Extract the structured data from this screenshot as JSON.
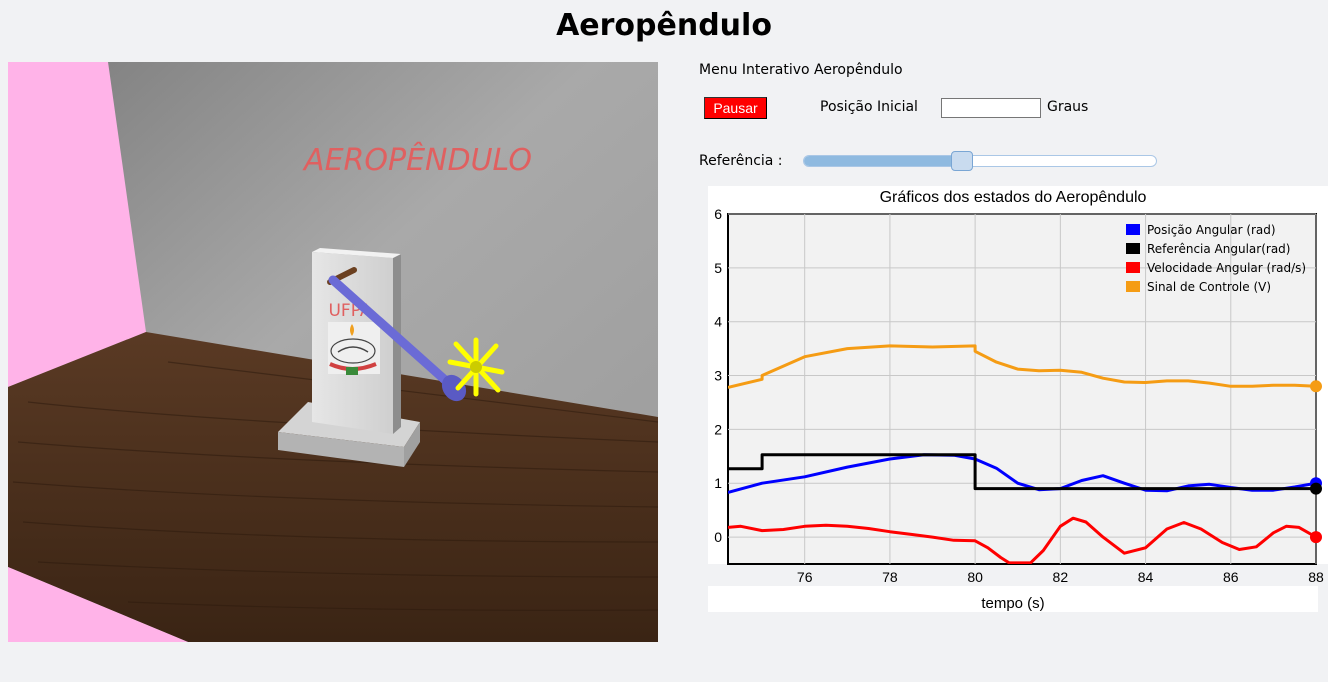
{
  "page": {
    "title": "Aeropêndulo"
  },
  "scene": {
    "wall_text": "AEROPÊNDULO",
    "logo_text": "UFPA",
    "colors": {
      "left_wall": "#ffb3e8",
      "back_wall": "#9e9e9e",
      "table": "#4a2e1c",
      "arm": "#6b6bd6",
      "propeller": "#ffff00"
    }
  },
  "menu": {
    "title": "Menu Interativo Aeropêndulo",
    "pause_label": "Pausar",
    "initial_position_label": "Posição Inicial",
    "initial_position_value": "",
    "initial_position_unit": "Graus",
    "reference_label": "Referência :",
    "reference_slider_fraction": 0.45
  },
  "chart_data": {
    "type": "line",
    "title": "Gráficos dos estados do Aeropêndulo",
    "xlabel": "tempo (s)",
    "ylabel": "",
    "xlim": [
      74.2,
      88
    ],
    "ylim": [
      -0.5,
      6
    ],
    "xticks": [
      76,
      78,
      80,
      82,
      84,
      86,
      88
    ],
    "yticks": [
      0,
      1,
      2,
      3,
      4,
      5,
      6
    ],
    "grid": true,
    "legend_position": "top-right",
    "series": [
      {
        "name": "Posição Angular (rad)",
        "color": "#0000ff",
        "x": [
          74.2,
          75,
          76,
          77,
          78,
          78.8,
          79.5,
          80,
          80.5,
          81,
          81.5,
          82,
          82.5,
          83,
          83.5,
          84,
          84.5,
          85,
          85.5,
          86,
          86.5,
          87,
          87.5,
          88
        ],
        "y": [
          0.83,
          1.0,
          1.12,
          1.3,
          1.45,
          1.53,
          1.52,
          1.45,
          1.28,
          1.0,
          0.88,
          0.9,
          1.05,
          1.14,
          1.0,
          0.87,
          0.86,
          0.95,
          0.98,
          0.92,
          0.87,
          0.87,
          0.93,
          1.0
        ]
      },
      {
        "name": "Referência Angular(rad)",
        "color": "#000000",
        "x": [
          74.2,
          75,
          75,
          80,
          80,
          88
        ],
        "y": [
          1.27,
          1.27,
          1.53,
          1.53,
          0.9,
          0.9
        ]
      },
      {
        "name": "Velocidade Angular (rad/s)",
        "color": "#ff0000",
        "x": [
          74.2,
          74.5,
          75,
          75.5,
          76,
          76.5,
          77,
          77.5,
          78,
          78.5,
          79,
          79.5,
          80,
          80.3,
          80.6,
          80.8,
          81.3,
          81.6,
          82,
          82.3,
          82.6,
          83,
          83.5,
          84,
          84.5,
          84.9,
          85.3,
          85.8,
          86.2,
          86.6,
          87,
          87.3,
          87.6,
          88
        ],
        "y": [
          0.18,
          0.2,
          0.12,
          0.14,
          0.2,
          0.22,
          0.2,
          0.16,
          0.1,
          0.05,
          0.0,
          -0.06,
          -0.07,
          -0.2,
          -0.38,
          -0.48,
          -0.48,
          -0.25,
          0.2,
          0.35,
          0.28,
          0.0,
          -0.3,
          -0.2,
          0.15,
          0.27,
          0.15,
          -0.1,
          -0.23,
          -0.18,
          0.08,
          0.2,
          0.18,
          0.0
        ]
      },
      {
        "name": "Sinal de Controle (V)",
        "color": "#f59c14",
        "x": [
          74.2,
          75,
          75,
          76,
          77,
          78,
          79,
          80,
          80,
          80.5,
          81,
          81.5,
          82,
          82.5,
          83,
          83.5,
          84,
          84.5,
          85,
          85.5,
          86,
          86.5,
          87,
          87.5,
          88
        ],
        "y": [
          2.78,
          2.93,
          3.0,
          3.35,
          3.5,
          3.55,
          3.53,
          3.55,
          3.45,
          3.25,
          3.12,
          3.09,
          3.1,
          3.06,
          2.95,
          2.88,
          2.87,
          2.9,
          2.9,
          2.86,
          2.8,
          2.8,
          2.82,
          2.82,
          2.8
        ]
      }
    ]
  }
}
